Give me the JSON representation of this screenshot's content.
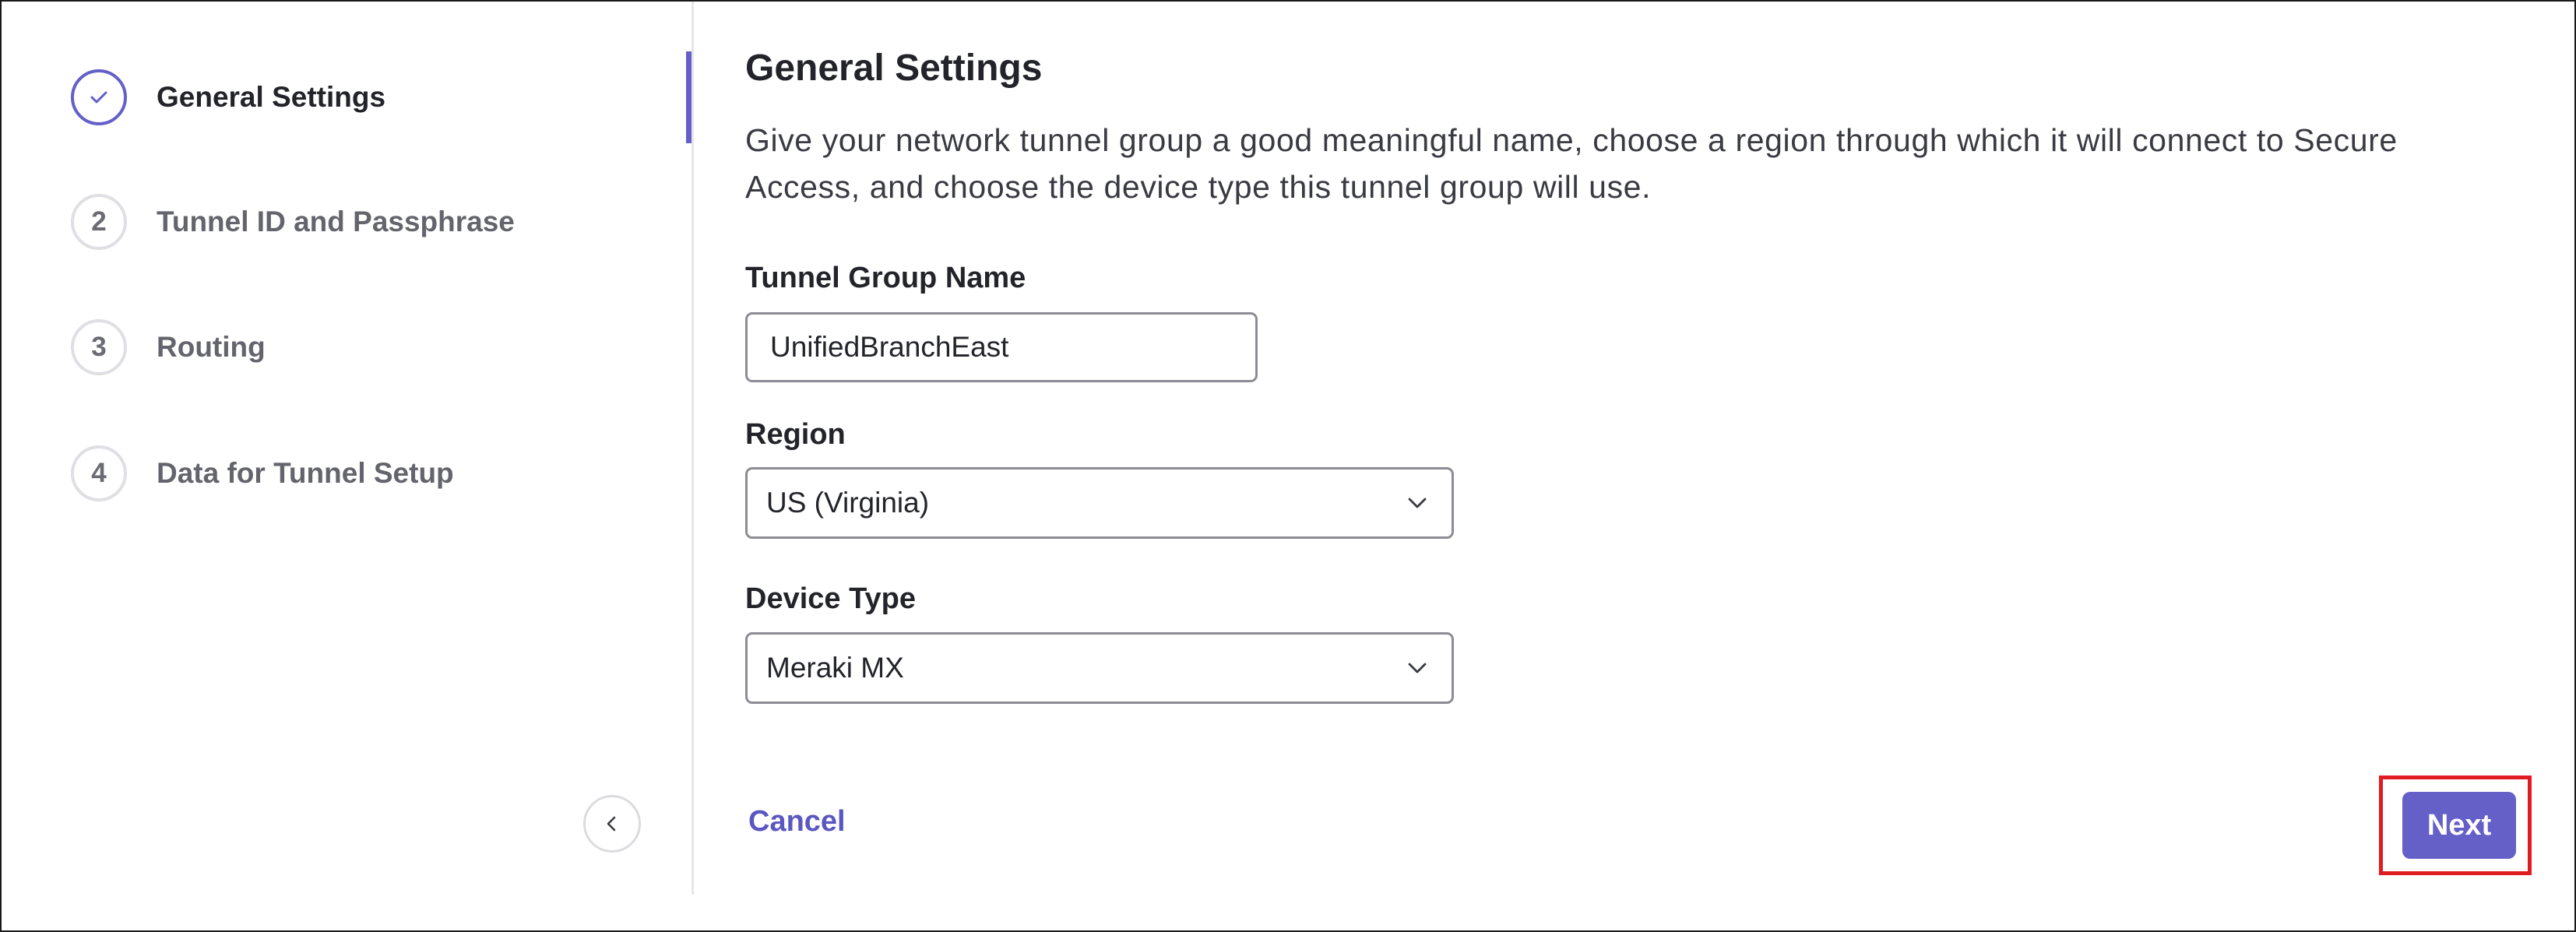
{
  "stepper": {
    "steps": [
      {
        "number": "",
        "label": "General Settings",
        "state": "completed",
        "icon": "checkmark-icon"
      },
      {
        "number": "2",
        "label": "Tunnel ID and Passphrase",
        "state": "pending"
      },
      {
        "number": "3",
        "label": "Routing",
        "state": "pending"
      },
      {
        "number": "4",
        "label": "Data for Tunnel Setup",
        "state": "pending"
      }
    ],
    "collapse_icon": "chevron-left-icon"
  },
  "main": {
    "title": "General Settings",
    "description": "Give your network tunnel group a good meaningful name, choose a region through which it will connect to Secure Access, and choose the device type this tunnel group will use.",
    "fields": {
      "tunnel_group_name": {
        "label": "Tunnel Group Name",
        "value": "UnifiedBranchEast"
      },
      "region": {
        "label": "Region",
        "value": "US (Virginia)",
        "icon": "chevron-down-icon"
      },
      "device_type": {
        "label": "Device Type",
        "value": "Meraki MX",
        "icon": "chevron-down-icon"
      }
    },
    "actions": {
      "cancel_label": "Cancel",
      "next_label": "Next"
    }
  },
  "colors": {
    "accent": "#6460c8",
    "highlight": "#e01b22",
    "border": "#8c8c94"
  }
}
